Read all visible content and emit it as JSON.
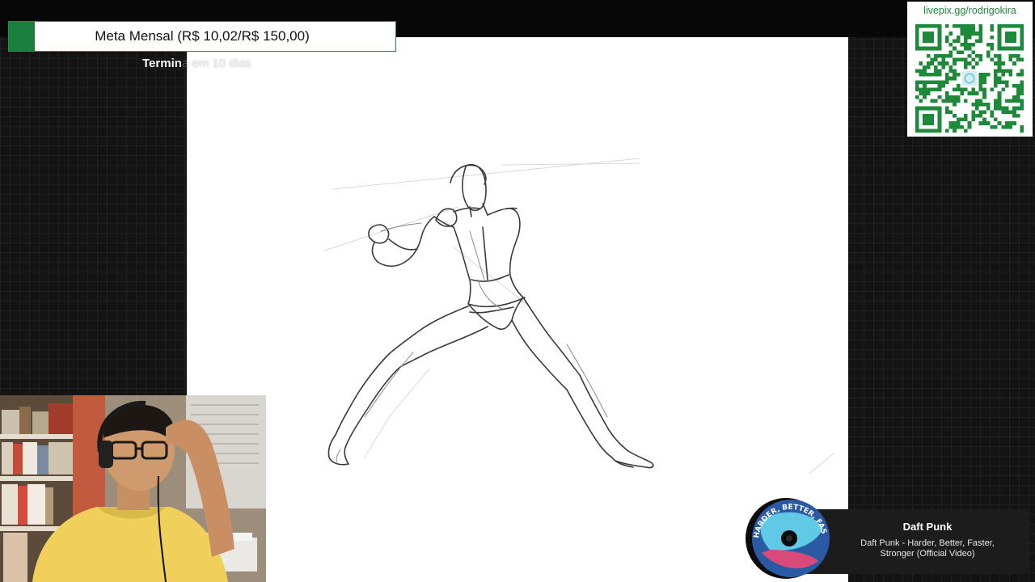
{
  "goal": {
    "label": "Meta Mensal (R$ 10,02/R$ 150,00)",
    "subtitle_visible": "Termin",
    "subtitle_faded": "a em 10 dias",
    "progress_fraction": 0.0668,
    "fill_color": "#1a7f3c"
  },
  "qr": {
    "title": "livepix.gg/rodrigokira",
    "color": "#1d8a3a"
  },
  "now_playing": {
    "artist": "Daft Punk",
    "track": "Daft Punk - Harder, Better, Faster, Stronger (Official Video)",
    "disc_text": "HARDER, BETTER, FASTER, STRONGER"
  },
  "colors": {
    "background": "#141414",
    "canvas": "#ffffff",
    "accent_green": "#1d8a3a"
  }
}
